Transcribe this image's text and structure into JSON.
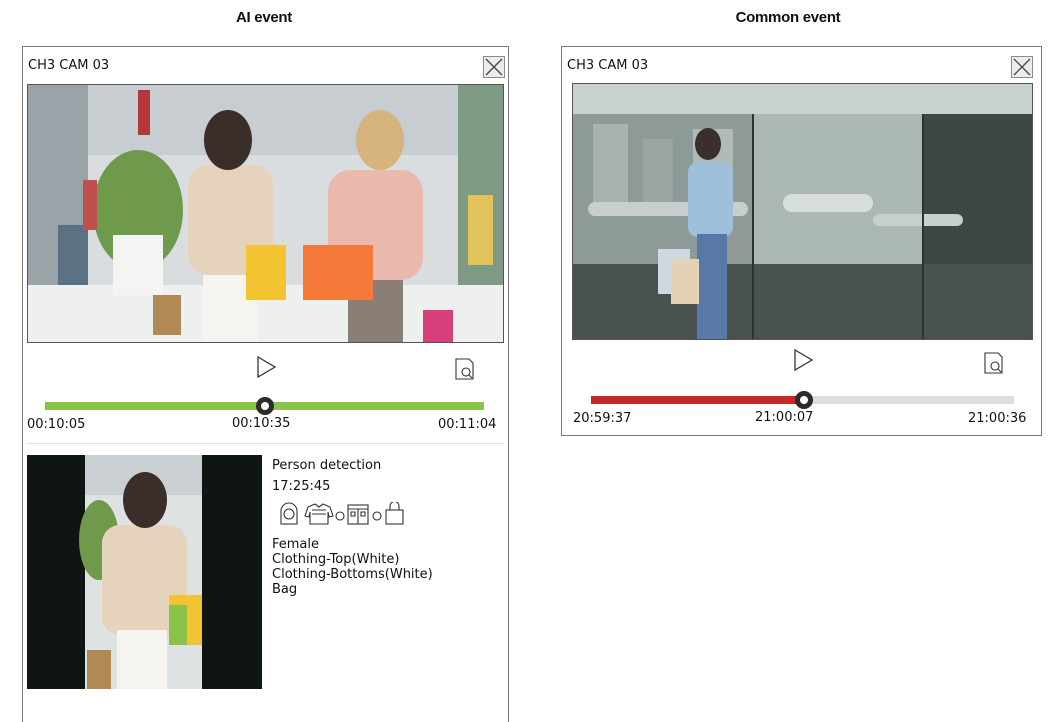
{
  "headings": {
    "left": "AI event",
    "right": "Common event"
  },
  "ai_panel": {
    "camera": "CH3 CAM 03",
    "timeline": {
      "start": "00:10:05",
      "current": "00:10:35",
      "end": "00:11:04",
      "progress": 0.5,
      "color": "#8bc34a"
    },
    "event": {
      "type": "Person detection",
      "time": "17:25:45",
      "attribute_icons": [
        "face-icon",
        "top-clothing-icon",
        "bottom-clothing-icon",
        "bag-icon"
      ],
      "attributes": [
        "Female",
        "Clothing-Top(White)",
        "Clothing-Bottoms(White)",
        "Bag"
      ]
    }
  },
  "common_panel": {
    "camera": "CH3 CAM 03",
    "timeline": {
      "start": "20:59:37",
      "current": "21:00:07",
      "end": "21:00:36",
      "progress": 0.5,
      "color": "#c62828"
    }
  },
  "icons": {
    "close": "close-icon",
    "play": "play-icon",
    "search": "image-search-icon"
  }
}
